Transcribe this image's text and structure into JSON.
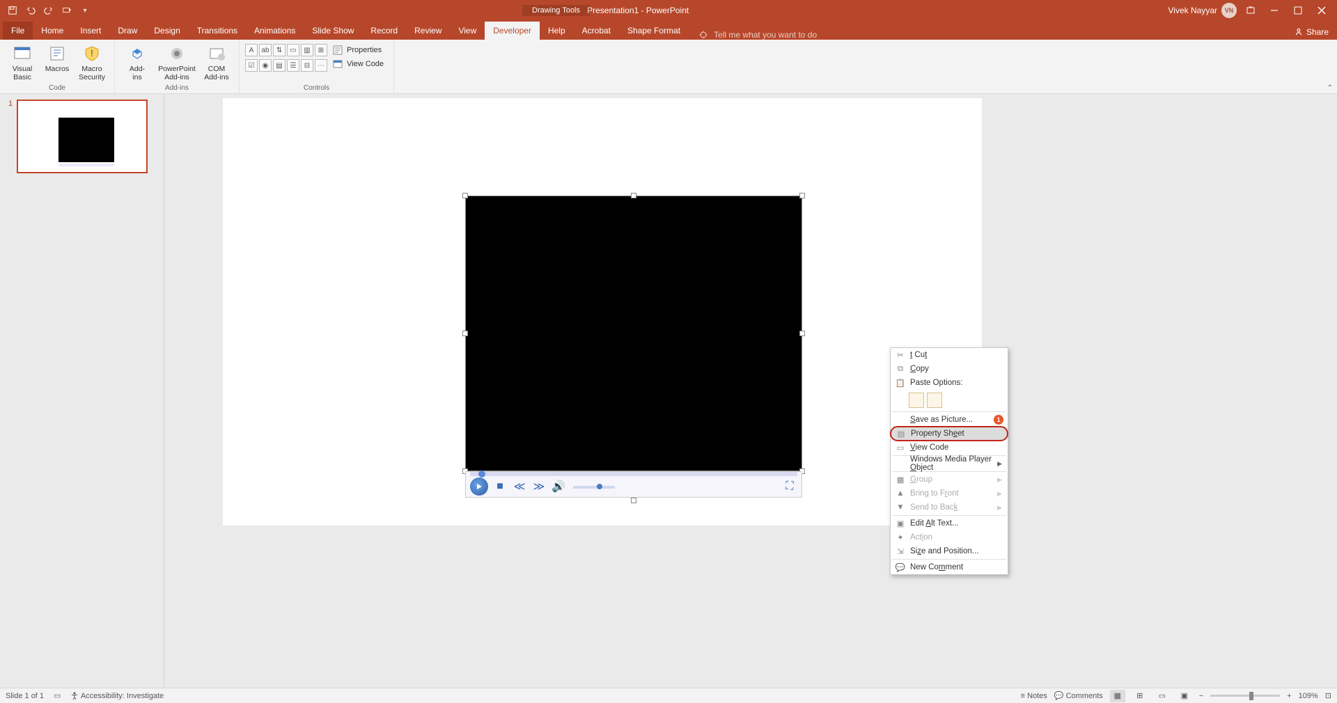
{
  "titlebar": {
    "doc_title": "Presentation1 - PowerPoint",
    "contextual": "Drawing Tools",
    "user": "Vivek Nayyar",
    "avatar": "VN"
  },
  "tabs": {
    "file": "File",
    "items": [
      "Home",
      "Insert",
      "Draw",
      "Design",
      "Transitions",
      "Animations",
      "Slide Show",
      "Record",
      "Review",
      "View",
      "Developer",
      "Help",
      "Acrobat",
      "Shape Format"
    ],
    "active": "Developer",
    "tellme": "Tell me what you want to do",
    "share": "Share"
  },
  "ribbon": {
    "code": {
      "visual_basic": "Visual\nBasic",
      "macros": "Macros",
      "macro_security": "Macro\nSecurity",
      "label": "Code"
    },
    "addins": {
      "addins": "Add-\nins",
      "ppt_addins": "PowerPoint\nAdd-ins",
      "com_addins": "COM\nAdd-ins",
      "label": "Add-ins"
    },
    "controls": {
      "properties": "Properties",
      "view_code": "View Code",
      "label": "Controls"
    }
  },
  "thumb": {
    "num": "1"
  },
  "context_menu": {
    "cut": "Cut",
    "copy": "Copy",
    "paste_options": "Paste Options:",
    "save_as_picture": "Save as Picture...",
    "property_sheet": "Property Sheet",
    "view_code": "View Code",
    "wmp_object": "Windows Media Player Object",
    "group": "Group",
    "bring_front": "Bring to Front",
    "send_back": "Send to Back",
    "edit_alt": "Edit Alt Text...",
    "action": "Action",
    "size_position": "Size and Position...",
    "new_comment": "New Comment",
    "badge": "1"
  },
  "status": {
    "slide": "Slide 1 of 1",
    "accessibility": "Accessibility: Investigate",
    "notes": "Notes",
    "comments": "Comments",
    "zoom": "109%"
  }
}
